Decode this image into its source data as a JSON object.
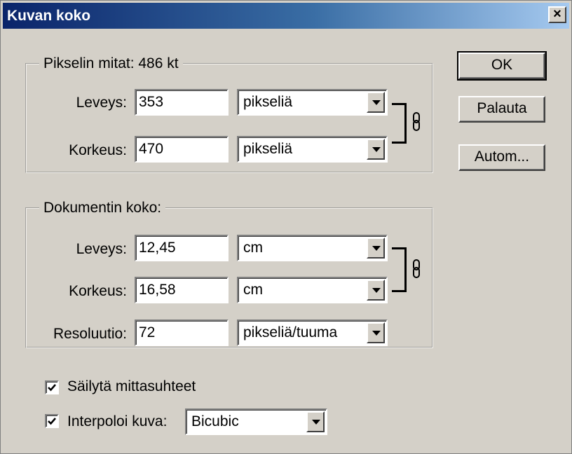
{
  "window": {
    "title": "Kuvan koko",
    "close_glyph": "×"
  },
  "pixel_dimensions": {
    "legend": "Pikselin mitat:  486 kt",
    "width": {
      "label": "Leveys:",
      "value": "353",
      "unit": "pikseliä"
    },
    "height": {
      "label": "Korkeus:",
      "value": "470",
      "unit": "pikseliä"
    },
    "link_icon": "chain-link-icon"
  },
  "document_size": {
    "legend": "Dokumentin koko:",
    "width": {
      "label": "Leveys:",
      "value": "12,45",
      "unit": "cm"
    },
    "height": {
      "label": "Korkeus:",
      "value": "16,58",
      "unit": "cm"
    },
    "resolution": {
      "label": "Resoluutio:",
      "value": "72",
      "unit": "pikseliä/tuuma"
    },
    "link_icon": "chain-link-icon"
  },
  "options": {
    "constrain_proportions": {
      "label": "Säilytä mittasuhteet",
      "checked": true
    },
    "resample": {
      "label": "Interpoloi kuva:",
      "checked": true,
      "method": "Bicubic"
    }
  },
  "buttons": {
    "ok": "OK",
    "reset": "Palauta",
    "auto": "Autom..."
  }
}
